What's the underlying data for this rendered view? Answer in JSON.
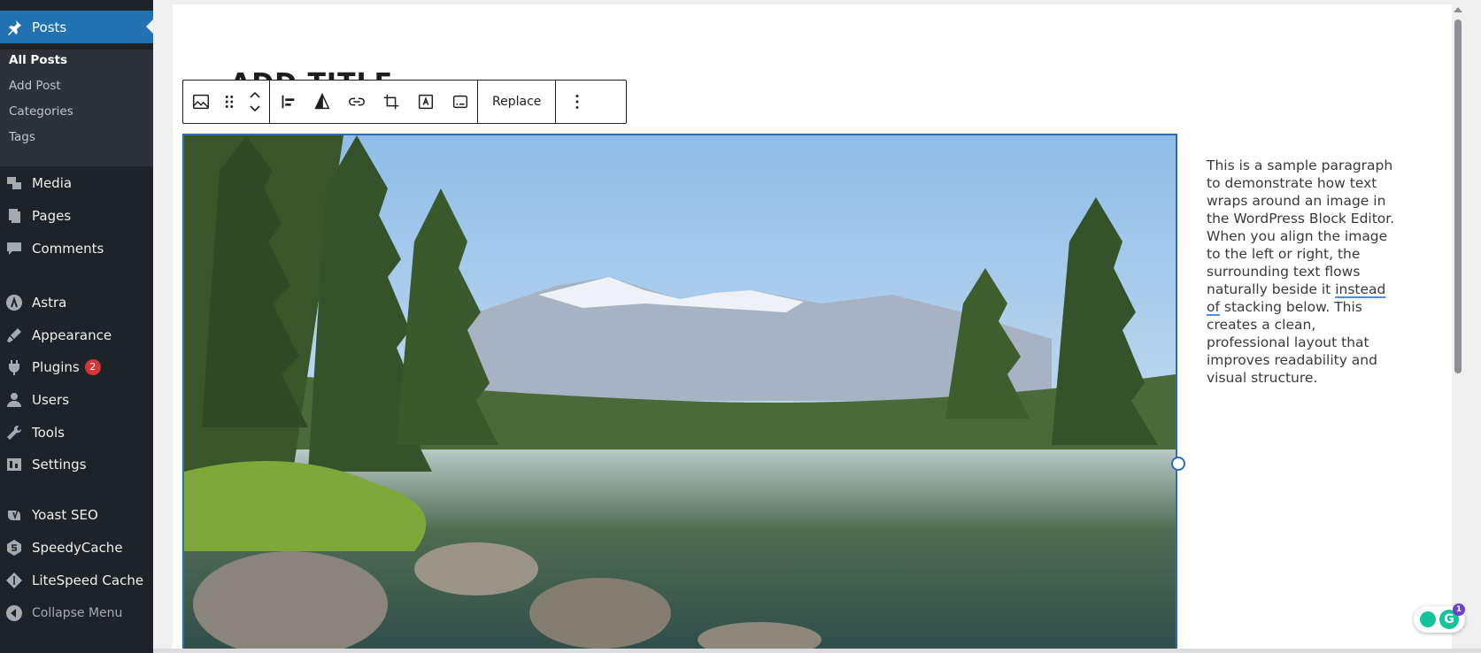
{
  "sidebar": {
    "posts_label": "Posts",
    "submenu": [
      "All Posts",
      "Add Post",
      "Categories",
      "Tags"
    ],
    "items": [
      {
        "label": "Media",
        "icon": "media-icon"
      },
      {
        "label": "Pages",
        "icon": "pages-icon"
      },
      {
        "label": "Comments",
        "icon": "comments-icon"
      },
      {
        "label": "Astra",
        "icon": "astra-icon"
      },
      {
        "label": "Appearance",
        "icon": "appearance-icon"
      },
      {
        "label": "Plugins",
        "icon": "plugins-icon",
        "badge": "2"
      },
      {
        "label": "Users",
        "icon": "users-icon"
      },
      {
        "label": "Tools",
        "icon": "tools-icon"
      },
      {
        "label": "Settings",
        "icon": "settings-icon"
      },
      {
        "label": "Yoast SEO",
        "icon": "yoast-icon"
      },
      {
        "label": "SpeedyCache",
        "icon": "speedycache-icon"
      },
      {
        "label": "LiteSpeed Cache",
        "icon": "litespeed-icon"
      }
    ],
    "collapse_label": "Collapse Menu"
  },
  "editor": {
    "title_placeholder": "ADD TITLE",
    "toolbar": {
      "replace_label": "Replace"
    },
    "paragraph": {
      "before": "This is a sample paragraph to demonstrate how text wraps around an image in the WordPress Block Editor. When you align the image to the left or right, the surrounding text flows naturally beside it ",
      "underlined": "instead of",
      "after": " stacking below. This creates a clean, professional layout that improves readability and visual structure."
    }
  },
  "grammarly": {
    "count": "1",
    "letter": "G"
  },
  "colors": {
    "sidebar_bg": "#1d2327",
    "active": "#2271b1",
    "badge": "#d63638",
    "selection": "#2a6fb8"
  }
}
